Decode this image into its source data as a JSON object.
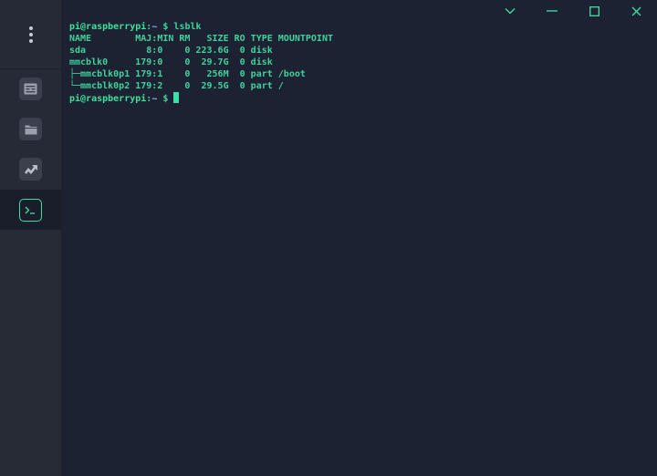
{
  "terminal": {
    "prompt_user": "pi@raspberrypi",
    "prompt_sep": ":",
    "prompt_path": "~",
    "prompt_symbol": " $ ",
    "command": "lsblk",
    "lines": [
      "NAME        MAJ:MIN RM   SIZE RO TYPE MOUNTPOINT",
      "sda           8:0    0 223.6G  0 disk",
      "mmcblk0     179:0    0  29.7G  0 disk",
      "├─mmcblk0p1 179:1    0   256M  0 part /boot",
      "└─mmcblk0p2 179:2    0  29.5G  0 part /"
    ]
  },
  "colors": {
    "accent": "#3ce0a6",
    "background": "#1d2233",
    "sidebar": "#262a36"
  },
  "icons": {
    "menu": "kebab-icon",
    "nav_1": "card-icon",
    "nav_2": "folder-icon",
    "nav_3": "share-icon",
    "nav_4": "terminal-icon",
    "window": [
      "chevron-down-icon",
      "minimize-icon",
      "maximize-icon",
      "close-icon"
    ]
  }
}
